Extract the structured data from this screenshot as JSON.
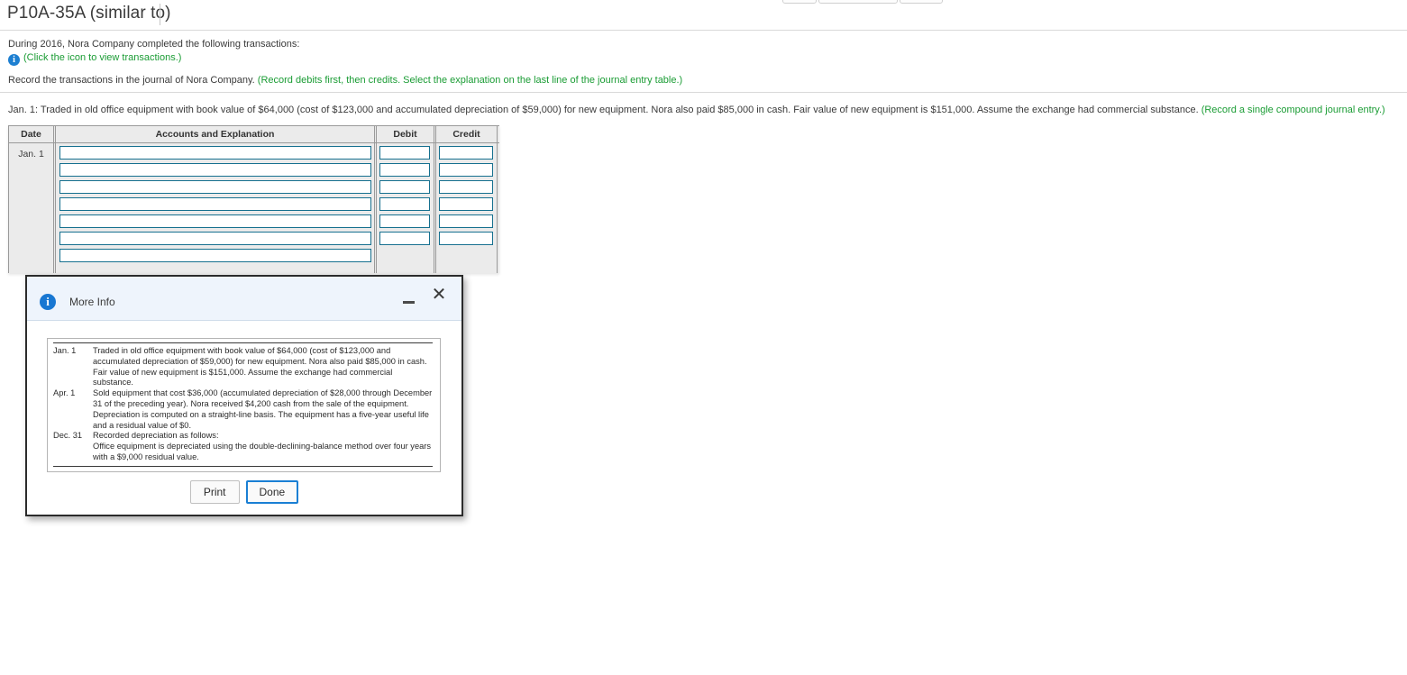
{
  "page": {
    "title": "P10A-35A (similar to)"
  },
  "toolbar": {
    "remnant_buttons": [
      "",
      "",
      ""
    ]
  },
  "problem": {
    "intro": "During 2016, Nora Company completed the following transactions:",
    "view_link": "(Click the icon to view transactions.)",
    "view_link_icon": "info-icon",
    "instruction_plain": "Record the transactions in the journal of Nora Company. ",
    "instruction_hint": "(Record debits first, then credits. Select the explanation on the last line of the journal entry table.)",
    "requirement_plain": "Jan. 1: Traded in old office equipment with book value of $64,000 (cost of $123,000 and accumulated depreciation of $59,000) for new equipment. Nora also paid $85,000 in cash. Fair value of new equipment is $151,000. Assume the exchange had commercial substance. ",
    "requirement_hint": "(Record a single compound journal entry.)"
  },
  "journal": {
    "headers": {
      "date": "Date",
      "accounts": "Accounts and Explanation",
      "debit": "Debit",
      "credit": "Credit"
    },
    "date_value": "Jan. 1",
    "account_rows": [
      "",
      "",
      "",
      "",
      "",
      "",
      ""
    ],
    "debit_rows": [
      "",
      "",
      "",
      "",
      "",
      ""
    ],
    "credit_rows": [
      "",
      "",
      "",
      "",
      "",
      ""
    ],
    "input_border_color": "#16708f"
  },
  "dialog": {
    "title": "More Info",
    "title_icon": "info-icon",
    "minimize_icon": "minimize-icon",
    "close_icon": "close-icon",
    "close_glyph": "✕",
    "transactions": [
      {
        "date": "Jan. 1",
        "text": "Traded in old office equipment with book value of $64,000 (cost of $123,000 and accumulated depreciation of $59,000) for new equipment. Nora also paid $85,000 in cash. Fair value of new equipment is $151,000. Assume the exchange had commercial substance.",
        "subline": ""
      },
      {
        "date": "Apr. 1",
        "text": "Sold equipment that cost $36,000 (accumulated depreciation of $28,000 through December 31 of the preceding year). Nora received $4,200 cash from the sale of the equipment. Depreciation is computed on a straight-line basis. The equipment has a five-year useful life and a residual value of $0.",
        "subline": ""
      },
      {
        "date": "Dec. 31",
        "text": "Recorded depreciation as follows:",
        "subline": "Office equipment is depreciated using the double-declining-balance method over four years with a $9,000 residual value."
      }
    ],
    "print_label": "Print",
    "done_label": "Done"
  },
  "colors": {
    "link_green": "#1a9c34",
    "info_blue": "#1877d2",
    "input_border": "#16708f",
    "focus_blue": "#1a7fd4"
  }
}
